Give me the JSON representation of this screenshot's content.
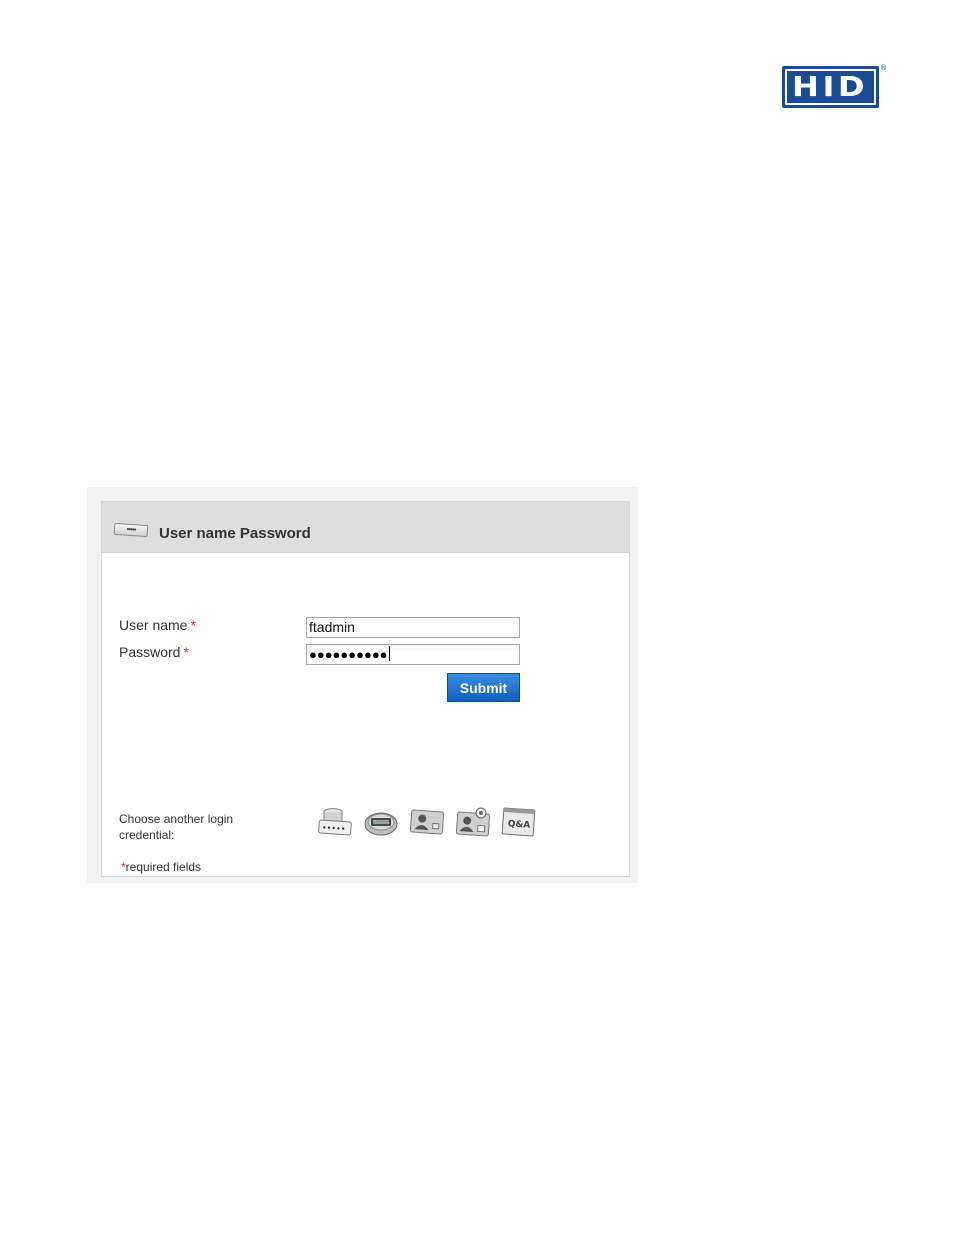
{
  "brand": {
    "logo_text": "HID",
    "registered_mark": "®",
    "logo_color": "#1a4c96"
  },
  "login_panel": {
    "title": "User name Password",
    "header_icon": "password-card-icon",
    "fields": {
      "username": {
        "label": "User name",
        "required_marker": "*",
        "value": "ftadmin"
      },
      "password": {
        "label": "Password",
        "required_marker": "*",
        "masked_value": "●●●●●●●●●●"
      }
    },
    "submit_label": "Submit",
    "submit_color": "#1e6fcf",
    "choose_credential_label": "Choose another login credential:",
    "credential_options": [
      {
        "icon": "database-password-icon"
      },
      {
        "icon": "otp-token-icon"
      },
      {
        "icon": "smart-card-icon"
      },
      {
        "icon": "certificate-card-icon"
      },
      {
        "icon": "q-and-a-icon",
        "text": "Q&A"
      }
    ],
    "required_note": {
      "marker": "*",
      "text": "required fields"
    },
    "required_color": "#d62a2a"
  }
}
